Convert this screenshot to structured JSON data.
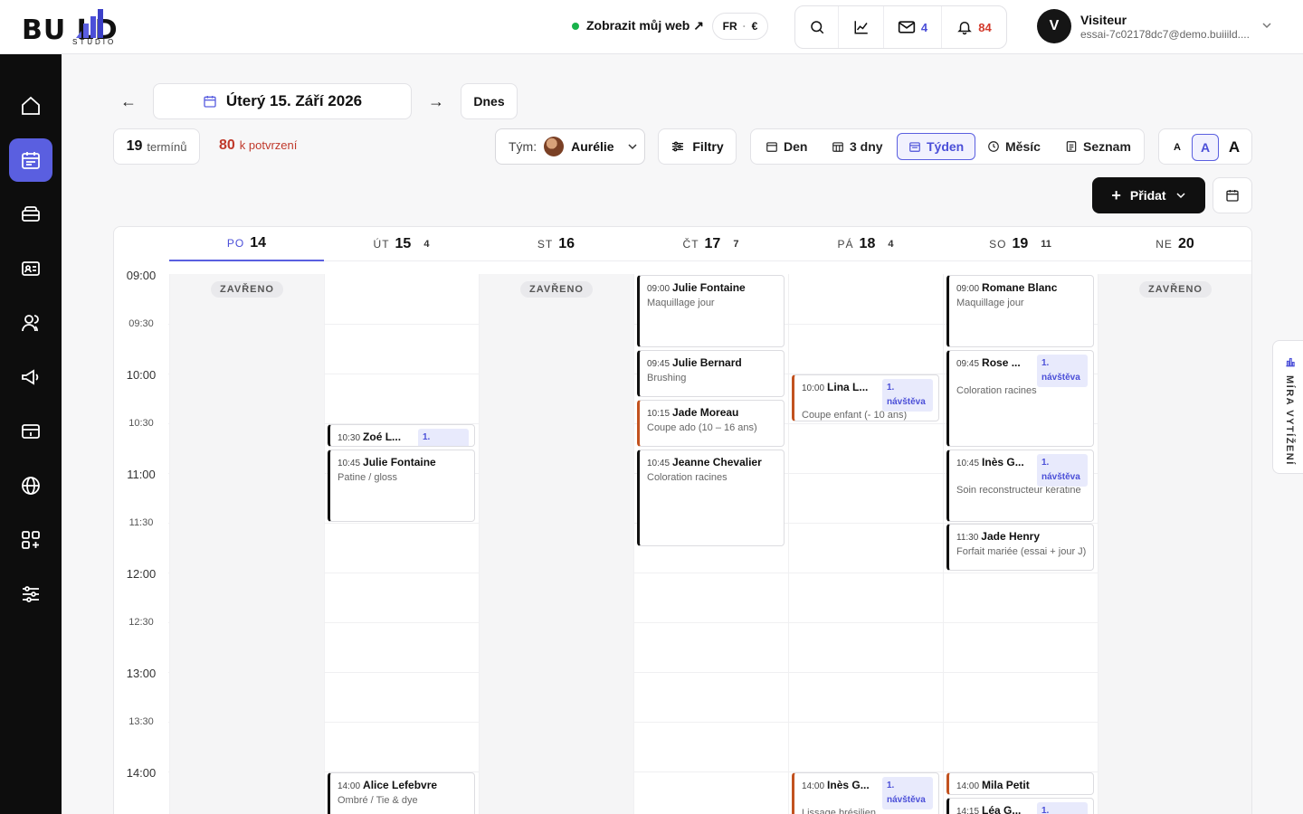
{
  "brand": {
    "word": "BU LD",
    "sub": "STUDIO"
  },
  "topbar": {
    "show_web": "Zobrazit můj web ↗",
    "lang": "FR",
    "currency": "€",
    "mail_count": "4",
    "notif_count": "84",
    "user_initial": "V",
    "user_name": "Visiteur",
    "user_email": "essai-7c02178dc7@demo.buiiild...."
  },
  "nav": {
    "prev": "←",
    "next": "→",
    "date": "Úterý 15. Září 2026",
    "today": "Dnes"
  },
  "toolbar": {
    "count_num": "19",
    "count_label": "termínů",
    "confirm_num": "80",
    "confirm_label": "k potvrzení",
    "team_label": "Tým:",
    "team_name": "Aurélie",
    "filters": "Filtry",
    "views": [
      "Den",
      "3 dny",
      "Týden",
      "Měsíc",
      "Seznam"
    ],
    "active_view": "Týden",
    "sizes": [
      "A",
      "A",
      "A"
    ],
    "add": "Přidat"
  },
  "calendar": {
    "days": [
      {
        "name": "PO",
        "date": "14",
        "count": "",
        "closed": true
      },
      {
        "name": "ÚT",
        "date": "15",
        "count": "4",
        "closed": false
      },
      {
        "name": "ST",
        "date": "16",
        "count": "",
        "closed": true
      },
      {
        "name": "ČT",
        "date": "17",
        "count": "7",
        "closed": false
      },
      {
        "name": "PÁ",
        "date": "18",
        "count": "4",
        "closed": false
      },
      {
        "name": "SO",
        "date": "19",
        "count": "11",
        "closed": false
      },
      {
        "name": "NE",
        "date": "20",
        "count": "",
        "closed": true
      }
    ],
    "closed_label": "ZAVŘENO",
    "times": [
      "09:00",
      "09:30",
      "10:00",
      "10:30",
      "11:00",
      "11:30",
      "12:00",
      "12:30",
      "13:00",
      "13:30",
      "14:00"
    ],
    "visit_label": "1. návštěva",
    "events": [
      {
        "day": 1,
        "time": "10:30",
        "name": "Zoé L...",
        "service": "",
        "visit": true,
        "accent": "dark"
      },
      {
        "day": 1,
        "time": "10:45",
        "name": "Julie Fontaine",
        "service": "Patine / gloss",
        "visit": false,
        "accent": "dark"
      },
      {
        "day": 1,
        "time": "14:00",
        "name": "Alice Lefebvre",
        "service": "Ombré / Tie & dye",
        "visit": false,
        "accent": "dark"
      },
      {
        "day": 3,
        "time": "09:00",
        "name": "Julie Fontaine",
        "service": "Maquillage jour",
        "visit": false,
        "accent": "dark"
      },
      {
        "day": 3,
        "time": "09:45",
        "name": "Julie Bernard",
        "service": "Brushing",
        "visit": false,
        "accent": "dark"
      },
      {
        "day": 3,
        "time": "10:15",
        "name": "Jade Moreau",
        "service": "Coupe ado (10 – 16 ans)",
        "visit": false,
        "accent": "orange"
      },
      {
        "day": 3,
        "time": "10:45",
        "name": "Jeanne Chevalier",
        "service": "Coloration racines",
        "visit": false,
        "accent": "dark"
      },
      {
        "day": 4,
        "time": "10:00",
        "name": "Lina L...",
        "service": "Coupe enfant (- 10 ans)",
        "visit": true,
        "accent": "orange"
      },
      {
        "day": 4,
        "time": "14:00",
        "name": "Inès G...",
        "service": "Lissage brésilien",
        "visit": true,
        "accent": "orange"
      },
      {
        "day": 5,
        "time": "09:00",
        "name": "Romane Blanc",
        "service": "Maquillage jour",
        "visit": false,
        "accent": "dark"
      },
      {
        "day": 5,
        "time": "09:45",
        "name": "Rose ...",
        "service": "Coloration racines",
        "visit": true,
        "accent": "dark"
      },
      {
        "day": 5,
        "time": "10:45",
        "name": "Inès G...",
        "service": "Soin reconstructeur kératine",
        "visit": true,
        "accent": "dark"
      },
      {
        "day": 5,
        "time": "11:30",
        "name": "Jade Henry",
        "service": "Forfait mariée (essai + jour J)",
        "visit": false,
        "accent": "dark"
      },
      {
        "day": 5,
        "time": "14:00",
        "name": "Mila Petit",
        "service": "",
        "visit": false,
        "accent": "orange"
      },
      {
        "day": 5,
        "time": "14:15",
        "name": "Léa G...",
        "service": "",
        "visit": true,
        "accent": "dark"
      }
    ]
  },
  "side_tab": "MÍRA VYTÍŽENÍ",
  "colors": {
    "accent": "#5a5fe0",
    "sidebar": "#0d0d0d",
    "danger": "#c0392b",
    "orange": "#c2521f"
  }
}
